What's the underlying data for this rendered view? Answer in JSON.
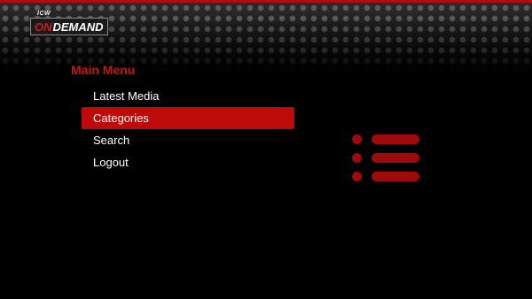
{
  "logo": {
    "small_text": "ICW",
    "on_text": "ON",
    "demand_text": "DEMAND"
  },
  "menu": {
    "title": "Main Menu",
    "items": [
      {
        "label": "Latest Media"
      },
      {
        "label": "Categories"
      },
      {
        "label": "Search"
      },
      {
        "label": "Logout"
      }
    ],
    "selected_index": 1
  },
  "decor": {
    "list_icon": "list-icon"
  },
  "colors": {
    "accent": "#bf0a0a",
    "title_red": "#c81414",
    "background": "#000000"
  }
}
